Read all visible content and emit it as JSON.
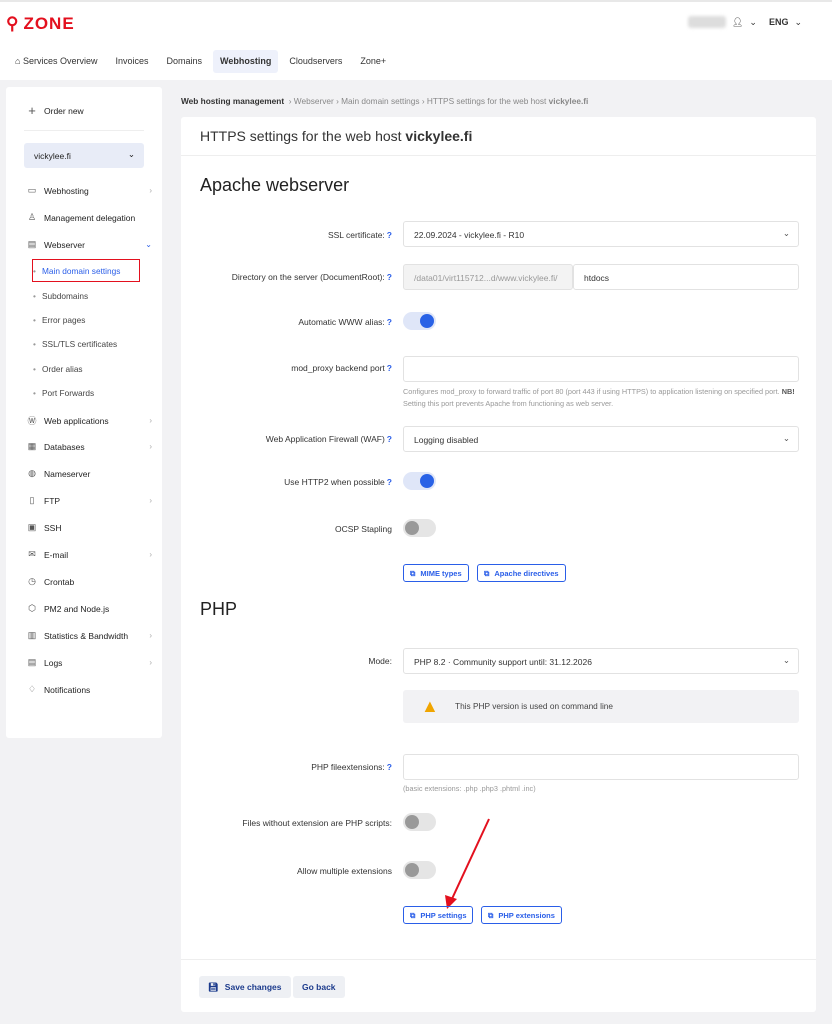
{
  "brand": "ZONE",
  "header": {
    "lang": "ENG"
  },
  "nav": [
    "Services Overview",
    "Invoices",
    "Domains",
    "Webhosting",
    "Cloudservers",
    "Zone+"
  ],
  "sidebar": {
    "order_new": "Order new",
    "domain": "vickylee.fi",
    "items": [
      "Webhosting",
      "Management delegation",
      "Webserver",
      "Web applications",
      "Databases",
      "Nameserver",
      "FTP",
      "SSH",
      "E-mail",
      "Crontab",
      "PM2 and Node.js",
      "Statistics & Bandwidth",
      "Logs",
      "Notifications"
    ],
    "sub": [
      "Main domain settings",
      "Subdomains",
      "Error pages",
      "SSL/TLS certificates",
      "Order alias",
      "Port Forwards"
    ]
  },
  "breadcrumb": {
    "root": "Web hosting management",
    "items": "› Webserver › Main domain settings › HTTPS settings for the web host",
    "host": "vickylee.fi"
  },
  "page": {
    "title": "HTTPS settings for the web host",
    "host": "vickylee.fi",
    "apache": "Apache webserver",
    "php": "PHP"
  },
  "form": {
    "ssl_label": "SSL certificate:",
    "ssl_value": "22.09.2024 - vickylee.fi - R10",
    "docroot_label": "Directory on the server (DocumentRoot):",
    "docroot_prefix": "/data01/virt115712...d/www.vickylee.fi/",
    "docroot_value": "htdocs",
    "www_label": "Automatic WWW alias:",
    "proxy_label": "mod_proxy backend port",
    "proxy_help": "Configures mod_proxy to forward traffic of port 80 (port 443 if using HTTPS) to application listening on specified port.",
    "proxy_nb": "NB!",
    "proxy_help2": "Setting this port prevents Apache from functioning as web server.",
    "waf_label": "Web Application Firewall (WAF)",
    "waf_value": "Logging disabled",
    "http2_label": "Use HTTP2 when possible",
    "ocsp_label": "OCSP Stapling",
    "mime": "MIME types",
    "apache_dir": "Apache directives",
    "mode_label": "Mode:",
    "mode_value": "PHP 8.2 · Community support until: 31.12.2026",
    "warn": "This PHP version is used on command line",
    "ext_label": "PHP fileextensions:",
    "ext_help": "(basic extensions: .php .php3 .phtml .inc)",
    "noext_label": "Files without extension are PHP scripts:",
    "multi_label": "Allow multiple extensions",
    "php_settings": "PHP settings",
    "php_ext": "PHP extensions",
    "save": "Save changes",
    "back": "Go back"
  },
  "colors": {
    "accent": "#2a5ee8",
    "brand": "#e3101e",
    "highlight": "#e3101e"
  }
}
